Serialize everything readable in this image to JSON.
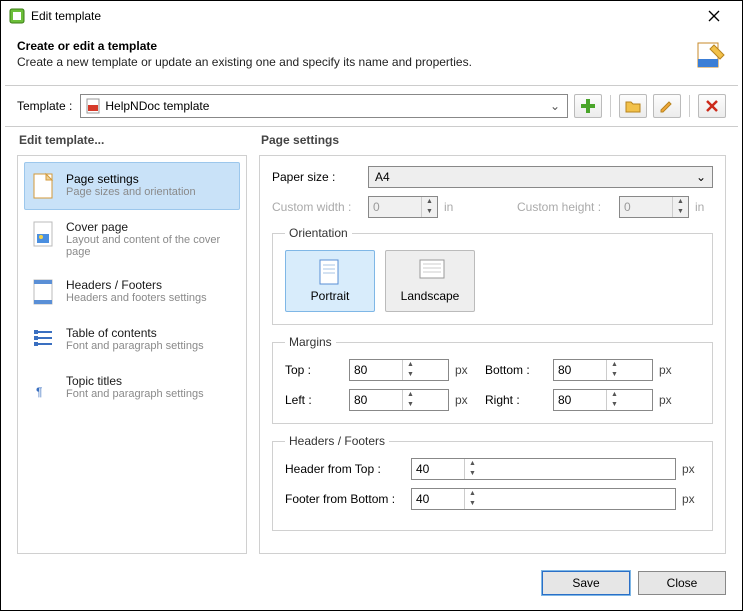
{
  "window": {
    "title": "Edit template"
  },
  "header": {
    "title": "Create or edit a template",
    "subtitle": "Create a new template or update an existing one and specify its name and properties."
  },
  "toolbar": {
    "label": "Template :",
    "selected": "HelpNDoc template"
  },
  "sidebar": {
    "title": "Edit template...",
    "items": [
      {
        "label": "Page settings",
        "desc": "Page sizes and orientation"
      },
      {
        "label": "Cover page",
        "desc": "Layout and content of the cover page"
      },
      {
        "label": "Headers / Footers",
        "desc": "Headers and footers settings"
      },
      {
        "label": "Table of contents",
        "desc": "Font and paragraph settings"
      },
      {
        "label": "Topic titles",
        "desc": "Font and paragraph settings"
      }
    ]
  },
  "page": {
    "title": "Page settings",
    "paper_label": "Paper size :",
    "paper_value": "A4",
    "custom_w_label": "Custom width :",
    "custom_w_value": "0",
    "custom_h_label": "Custom height :",
    "custom_h_value": "0",
    "unit_in": "in",
    "unit_px": "px",
    "orientation": {
      "legend": "Orientation",
      "portrait": "Portrait",
      "landscape": "Landscape"
    },
    "margins": {
      "legend": "Margins",
      "top_label": "Top :",
      "top": "80",
      "bottom_label": "Bottom :",
      "bottom": "80",
      "left_label": "Left :",
      "left": "80",
      "right_label": "Right :",
      "right": "80"
    },
    "hf": {
      "legend": "Headers / Footers",
      "header_label": "Header from Top :",
      "header": "40",
      "footer_label": "Footer from Bottom :",
      "footer": "40"
    }
  },
  "buttons": {
    "save": "Save",
    "close": "Close"
  }
}
